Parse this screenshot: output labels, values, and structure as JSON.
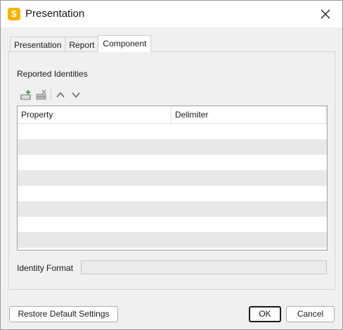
{
  "window": {
    "title": "Presentation",
    "app_icon_letter": "S",
    "close_glyph": "✕"
  },
  "tabs": [
    {
      "label": "Presentation",
      "active": false
    },
    {
      "label": "Report",
      "active": false
    },
    {
      "label": "Component",
      "active": true
    }
  ],
  "component": {
    "section_label": "Reported Identities",
    "toolbar": {
      "icons": [
        "add-row-icon",
        "delete-row-icon",
        "move-up-icon",
        "move-down-icon"
      ]
    },
    "table": {
      "columns": [
        "Property",
        "Delimiter"
      ],
      "rows": []
    },
    "identity_format_label": "Identity Format",
    "identity_format_value": ""
  },
  "buttons": {
    "restore": "Restore Default Settings",
    "ok": "OK",
    "cancel": "Cancel"
  },
  "colors": {
    "app_icon": "#f7b500",
    "row_alt": "#e8e8e8",
    "add_icon_green": "#3aa53a"
  }
}
